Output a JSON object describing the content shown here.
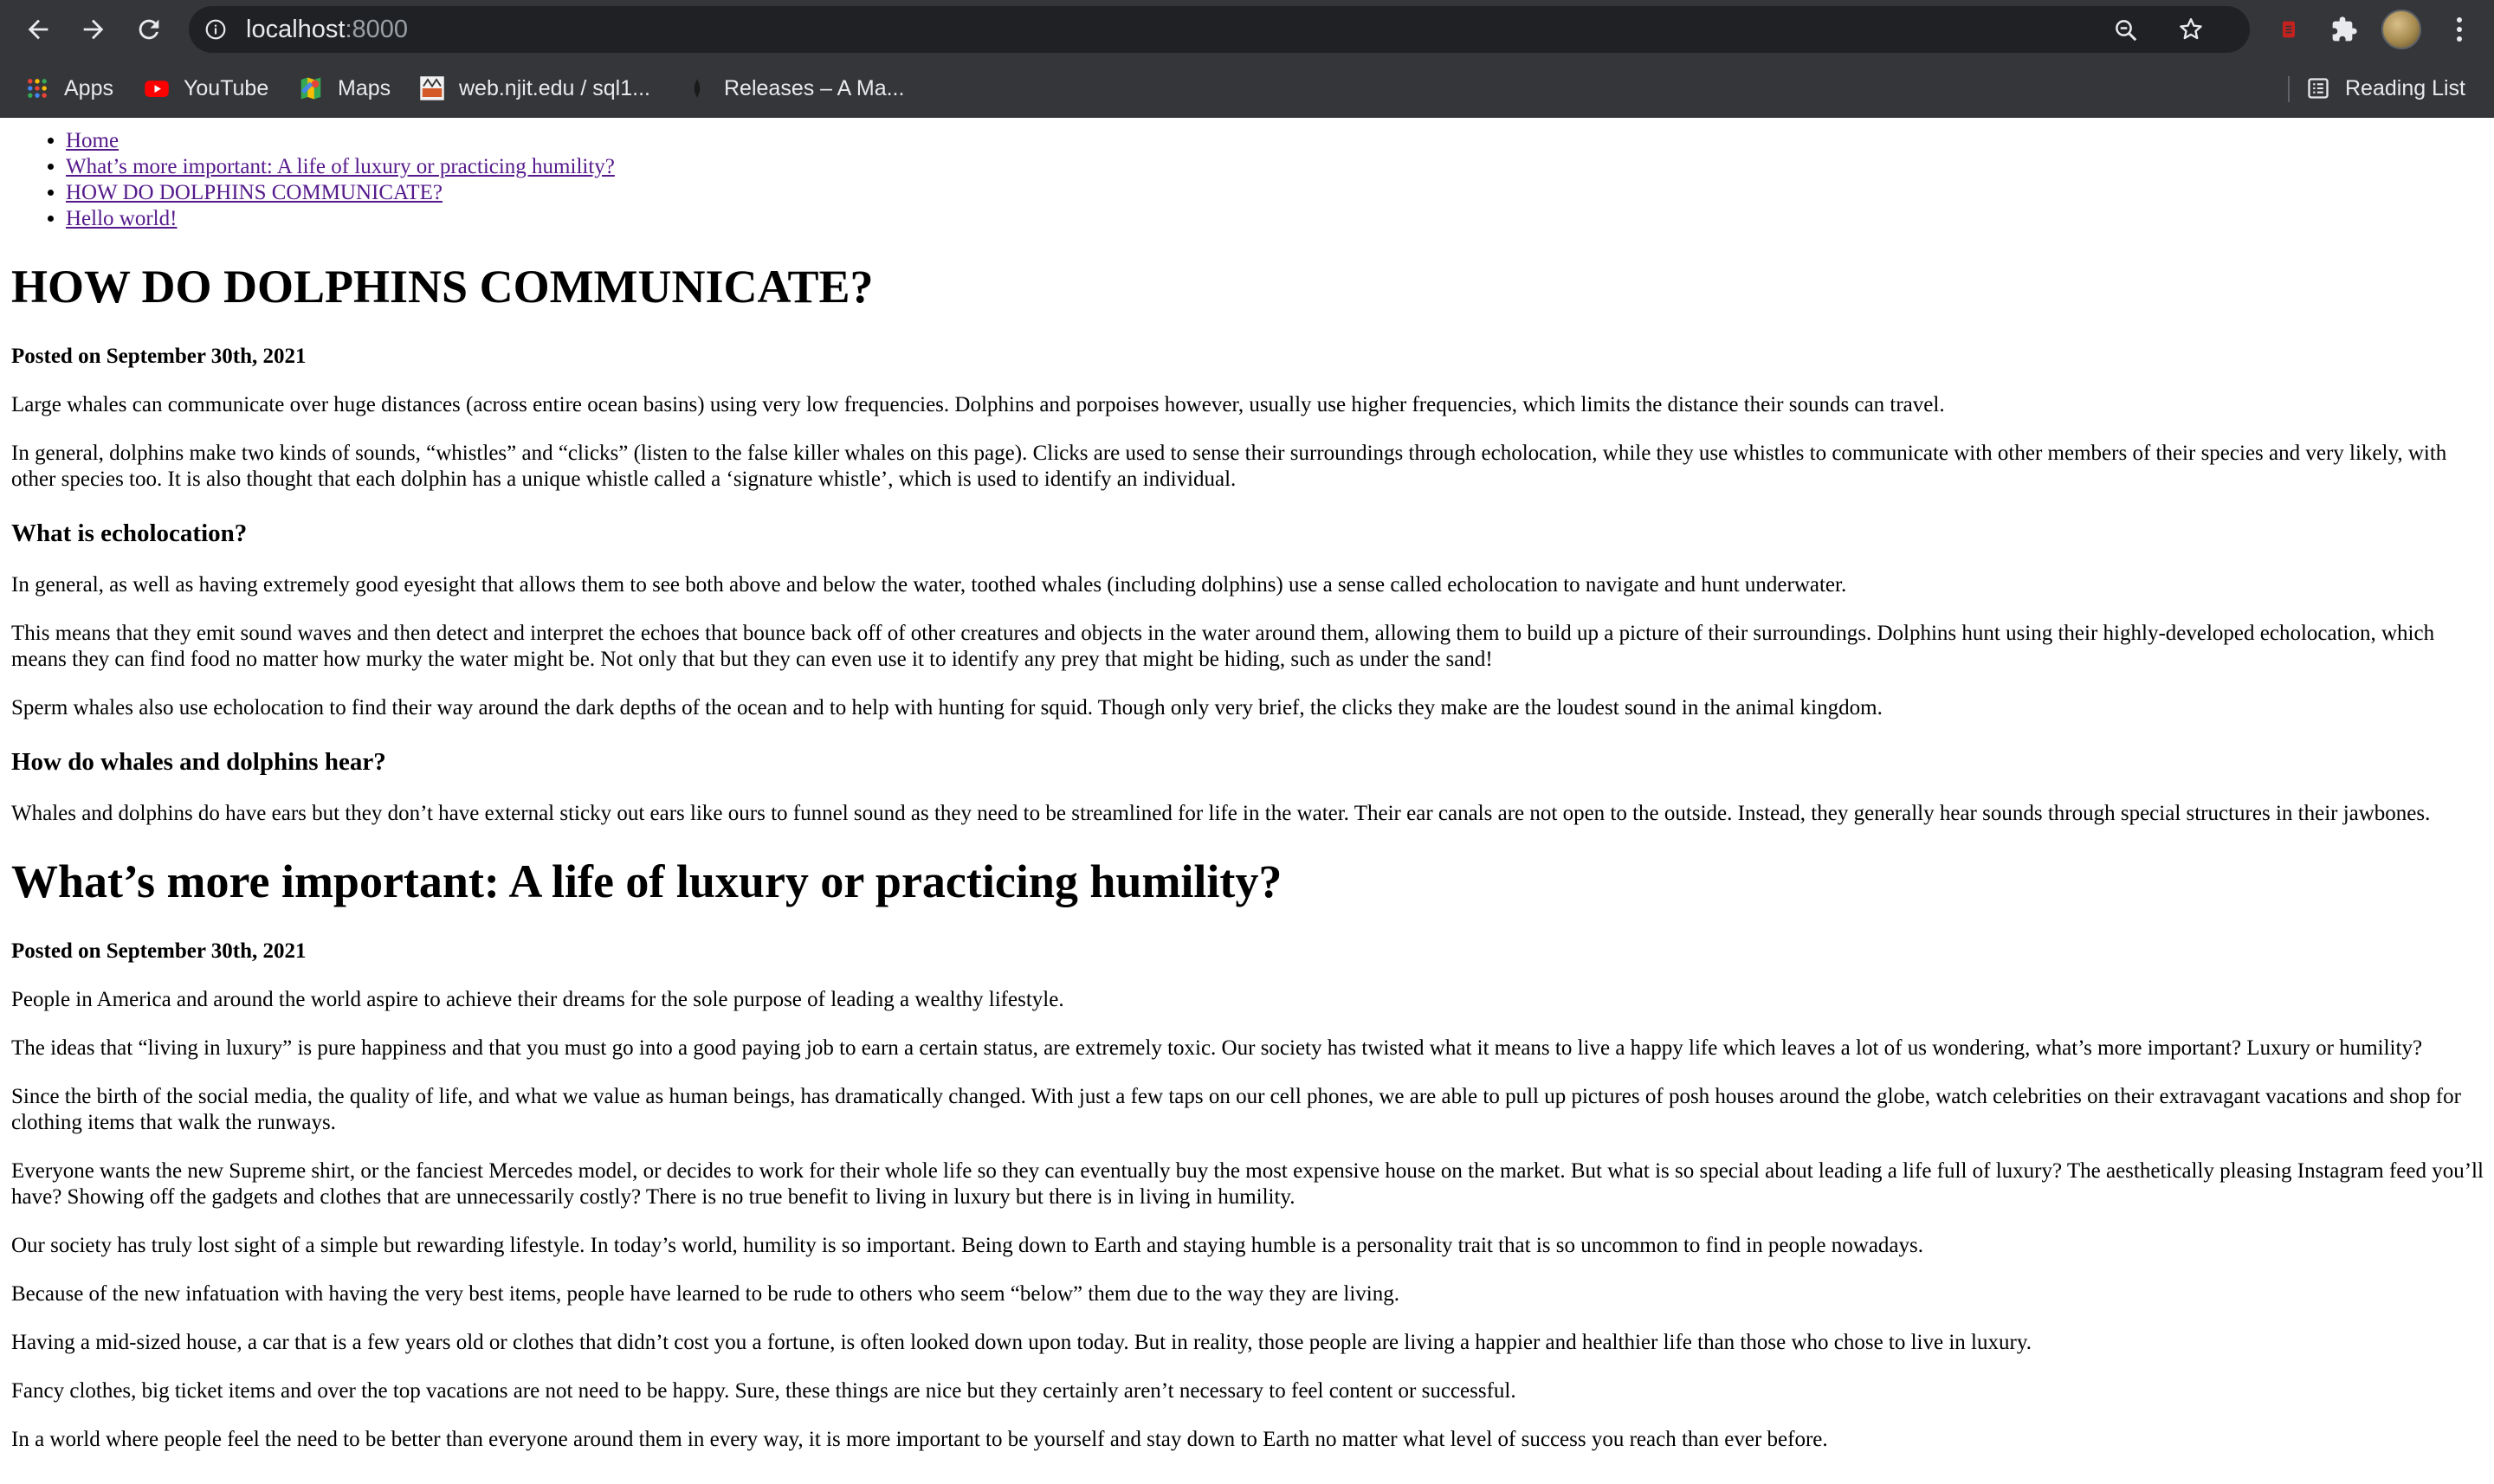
{
  "browser": {
    "url_host": "localhost",
    "url_port": ":8000",
    "bookmarks": [
      {
        "label": "Apps",
        "icon": "apps-grid-icon"
      },
      {
        "label": "YouTube",
        "icon": "youtube-icon"
      },
      {
        "label": "Maps",
        "icon": "maps-icon"
      },
      {
        "label": "web.njit.edu / sql1...",
        "icon": "njit-favicon"
      },
      {
        "label": "Releases – A Ma...",
        "icon": "github-favicon"
      }
    ],
    "reading_list_label": "Reading List",
    "colors": {
      "chrome_bg": "#35363a",
      "omnibox_bg": "#202124",
      "link_visited": "#551a8b"
    }
  },
  "nav": {
    "links": [
      "Home",
      "What’s more important: A life of luxury or practicing humility?",
      "HOW DO DOLPHINS COMMUNICATE?",
      "Hello world!"
    ]
  },
  "posts": [
    {
      "title": "HOW DO DOLPHINS COMMUNICATE?",
      "posted": "Posted on September 30th, 2021",
      "intro": [
        "Large whales can communicate over huge distances (across entire ocean basins) using very low frequencies. Dolphins and porpoises however, usually use higher frequencies, which limits the distance their sounds can travel.",
        "In general, dolphins make two kinds of sounds, “whistles” and “clicks” (listen to the false killer whales on this page). Clicks are used to sense their surroundings through echolocation, while they use whistles to communicate with other members of their species and very likely, with other species too. It is also thought that each dolphin has a unique whistle called a ‘signature whistle’, which is used to identify an individual."
      ],
      "section1_heading": "What is echolocation?",
      "section1": [
        "In general, as well as having extremely good eyesight that allows them to see both above and below the water, toothed whales (including dolphins) use a sense called echolocation to navigate and hunt underwater.",
        "This means that they emit sound waves and then detect and interpret the echoes that bounce back off of other creatures and objects in the water around them, allowing them to build up a picture of their surroundings. Dolphins hunt using their highly-developed echolocation, which means they can find food no matter how murky the water might be. Not only that but they can even use it to identify any prey that might be hiding, such as under the sand!",
        "Sperm whales also use echolocation to find their way around the dark depths of the ocean and to help with hunting for squid. Though only very brief, the clicks they make are the loudest sound in the animal kingdom."
      ],
      "section2_heading": "How do whales and dolphins hear?",
      "section2": [
        "Whales and dolphins do have ears but they don’t have external sticky out ears like ours to funnel sound as they need to be streamlined for life in the water. Their ear canals are not open to the outside. Instead, they generally hear sounds through special structures in their jawbones."
      ]
    },
    {
      "title": "What’s more important: A life of luxury or practicing humility?",
      "posted": "Posted on September 30th, 2021",
      "paragraphs": [
        "People in America and around the world aspire to achieve their dreams for the sole purpose of leading a wealthy lifestyle.",
        "The ideas that “living in luxury” is pure happiness and that you must go into a good paying job to earn a certain status, are extremely toxic. Our society has twisted what it means to live a happy life which leaves a lot of us wondering, what’s more important? Luxury or humility?",
        "Since the birth of the social media, the quality of life, and what we value as human beings, has dramatically changed. With just a few taps on our cell phones, we are able to pull up pictures of posh houses around the globe, watch celebrities on their extravagant vacations and shop for clothing items that walk the runways.",
        "Everyone wants the new Supreme shirt, or the fanciest Mercedes model, or decides to work for their whole life so they can eventually buy the most expensive house on the market. But what is so special about leading a life full of luxury? The aesthetically pleasing Instagram feed you’ll have? Showing off the gadgets and clothes that are unnecessarily costly? There is no true benefit to living in luxury but there is in living in humility.",
        "Our society has truly lost sight of a simple but rewarding lifestyle. In today’s world, humility is so important. Being down to Earth and staying humble is a personality trait that is so uncommon to find in people nowadays.",
        "Because of the new infatuation with having the very best items, people have learned to be rude to others who seem “below” them due to the way they are living.",
        "Having a mid-sized house, a car that is a few years old or clothes that didn’t cost you a fortune, is often looked down upon today. But in reality, those people are living a happier and healthier life than those who chose to live in luxury.",
        "Fancy clothes, big ticket items and over the top vacations are not need to be happy. Sure, these things are nice but they certainly aren’t necessary to feel content or successful.",
        "In a world where people feel the need to be better than everyone around them in every way, it is more important to be yourself and stay down to Earth no matter what level of success you reach than ever before."
      ]
    }
  ]
}
